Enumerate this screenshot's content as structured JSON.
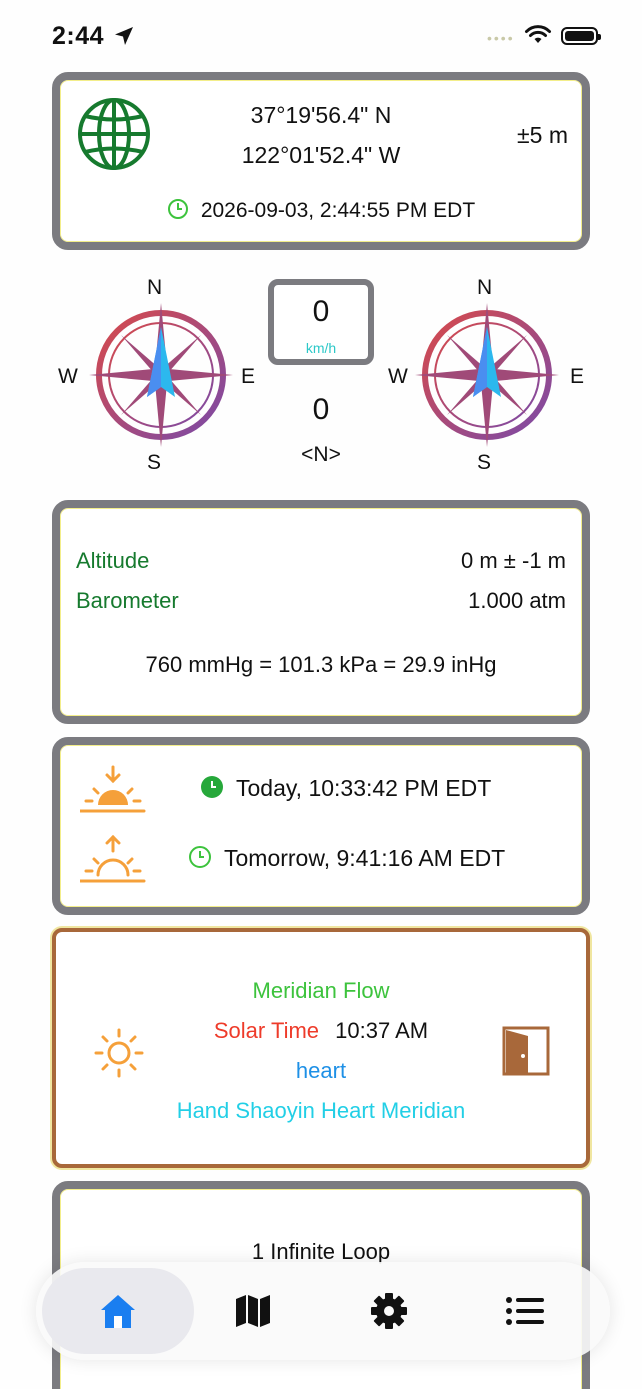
{
  "status_bar": {
    "time": "2:44"
  },
  "location": {
    "latitude": "37°19'56.4\" N",
    "longitude": "122°01'52.4\" W",
    "accuracy": "±5 m",
    "timestamp": "2026-09-03, 2:44:55 PM EDT"
  },
  "compass": {
    "north": "N",
    "south": "S",
    "east": "E",
    "west": "W",
    "speed_value": "0",
    "speed_unit": "km/h",
    "heading_value": "0",
    "heading_direction": "<N>"
  },
  "altitude": {
    "altitude_label": "Altitude",
    "altitude_value": "0 m ± -1 m",
    "barometer_label": "Barometer",
    "barometer_value": "1.000  atm",
    "pressure_conversions": "760 mmHg = 101.3 kPa = 29.9 inHg"
  },
  "sun": {
    "sunset_time": "Today, 10:33:42 PM EDT",
    "sunrise_time": "Tomorrow, 9:41:16 AM EDT"
  },
  "meridian": {
    "title": "Meridian Flow",
    "solar_label": "Solar Time",
    "solar_time": "10:37 AM",
    "organ": "heart",
    "meridian_name": "Hand Shaoyin Heart Meridian"
  },
  "address": {
    "line1": "1 Infinite Loop"
  },
  "tabs": [
    "Home",
    "Map",
    "Settings",
    "List"
  ],
  "colors": {
    "green": "#167a2e",
    "meridian_green": "#3dc33d",
    "solar_red": "#ee3b2a",
    "organ_blue": "#1e90e6",
    "meridian_cyan": "#22cfe6",
    "sun_orange": "#f5a03a",
    "active_tab_blue": "#1a7ef0",
    "card_border": "#7b7b80"
  }
}
